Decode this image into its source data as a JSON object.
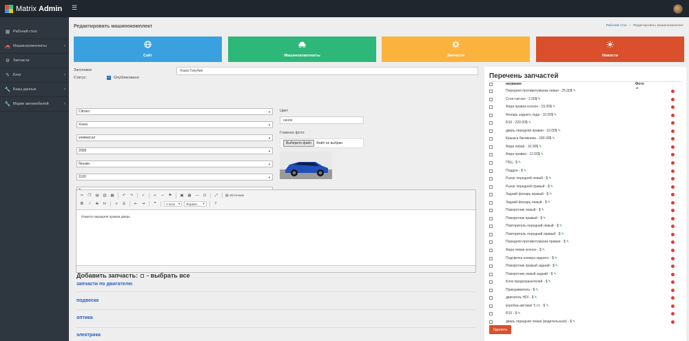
{
  "app": {
    "logo_light": "Matrix",
    "logo_bold": "Admin"
  },
  "icons": {
    "menu": "hamburger-icon",
    "tile_site": "globe-icon",
    "tile_kits": "car-icon",
    "tile_parts": "gear-icon",
    "tile_news": "sun-icon"
  },
  "colors": {
    "tile_site": "#3aa1e0",
    "tile_kits": "#2db87a",
    "tile_parts": "#fbb33d",
    "tile_news": "#da4f2c",
    "topbar": "#1f262d",
    "sidebar": "#2e363f"
  },
  "sidebar": {
    "items": [
      {
        "label": "Рабочий стол",
        "icon": "dashboard-icon",
        "chevron": ""
      },
      {
        "label": "Машинокомплекты",
        "icon": "car-icon",
        "chevron": "›"
      },
      {
        "label": "Запчасти",
        "icon": "gear-icon",
        "chevron": ""
      },
      {
        "label": "Блог",
        "icon": "edit-icon",
        "chevron": "›"
      },
      {
        "label": "Базы данных",
        "icon": "wrench-icon",
        "chevron": "›"
      },
      {
        "label": "Марки автомобилей",
        "icon": "wrench-icon",
        "chevron": "›"
      }
    ]
  },
  "page": {
    "title": "Редактировать машинокомплект",
    "breadcrumb": [
      "Рабочий стол",
      "Редактировать машинокомплект"
    ]
  },
  "tiles": [
    {
      "label": "Сайт"
    },
    {
      "label": "Машинокомплекты"
    },
    {
      "label": "Запчасти"
    },
    {
      "label": "Новости"
    }
  ],
  "form": {
    "title_label": "Заголовок",
    "title_value": "Xsara Голубая",
    "status_label": "Статус:",
    "published_label": "Опубликовано",
    "published": true,
    "selects": [
      "Citroen",
      "Xsara",
      "универсал",
      "2008",
      "бензин",
      "1100",
      "3"
    ],
    "color_label": "Цвет",
    "color_value": "синяя",
    "main_photo_label": "Главное фото",
    "file_button": "Выберите файл",
    "file_status": "Файл не выбран"
  },
  "editor": {
    "source_label": "Источник",
    "styles_label": "Стили",
    "format_label": "Формат...",
    "content": "Помята передняя правая дверь."
  },
  "add_parts": {
    "title_part1": "Добавить запчасть:",
    "title_part2": "- выбрать все",
    "categories": [
      "запчасти по двигателю",
      "подвеска",
      "оптика",
      "электрика"
    ]
  },
  "parts_panel": {
    "title": "Перечень запчастей",
    "col_name": "название",
    "col_photo": "Фото",
    "delete_button": "Удалить",
    "items": [
      "Передняя противотуманка левая - 25.00$",
      "Стоп-сигнал - 2.00$",
      "Фара правая ксенон - 15.00$",
      "Фонарь заднего хода - 10.00$",
      "R16 - 220.00$",
      "дверь передняя правая - 10.00$",
      "Крышка багажника - 180.00$",
      "Фара левая - 10.00$",
      "Фара правая - 12.00$",
      "ГБЦ - $",
      "Поддон - $",
      "Рычаг передний левый - $",
      "Рычаг передний правый - $",
      "Задний фонарь правый - $",
      "Задний фонарь левый - $",
      "Поворотник левый - $",
      "Поворотник правый - $",
      "Повторитель передний левый - $",
      "Повторитель передний правый - $",
      "Передняя противотуманка правая - $",
      "Фара левая ксенон - $",
      "Подсветка номера заднего - $",
      "Поворотник правый задний - $",
      "Поворотник левый задний - $",
      "Блок предохранителей - $",
      "Прикуриватель - $",
      "двигатель HDI - $",
      "коробка-автомат 5 ст. - $",
      "R15 - $",
      "дверь передняя левая (водительская) - $"
    ]
  }
}
